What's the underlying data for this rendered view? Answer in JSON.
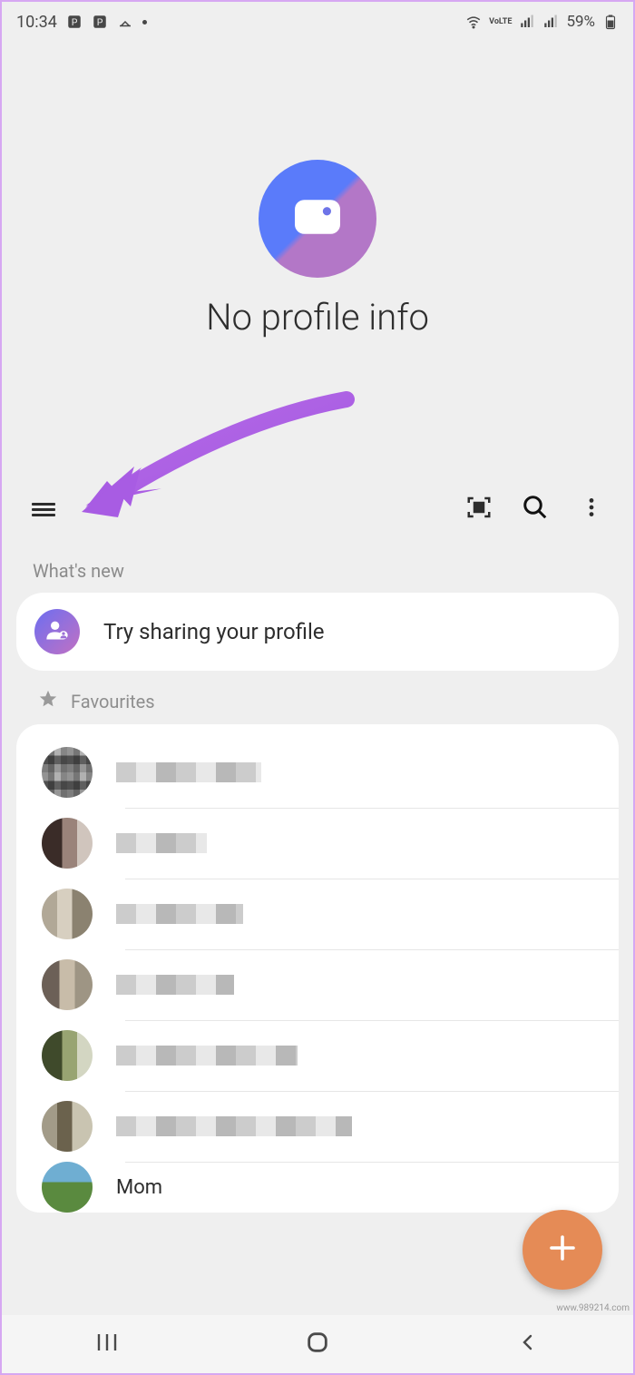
{
  "status_bar": {
    "time": "10:34",
    "battery_pct": "59%",
    "volte_label": "VoLTE"
  },
  "profile": {
    "title": "No profile info"
  },
  "whats_new": {
    "section_label": "What's new",
    "card_text": "Try sharing your profile"
  },
  "favourites": {
    "label": "Favourites",
    "items": [
      {
        "name": ""
      },
      {
        "name": ""
      },
      {
        "name": ""
      },
      {
        "name": ""
      },
      {
        "name": ""
      },
      {
        "name": ""
      },
      {
        "name": "Mom"
      }
    ]
  },
  "watermark": "www.989214.com"
}
